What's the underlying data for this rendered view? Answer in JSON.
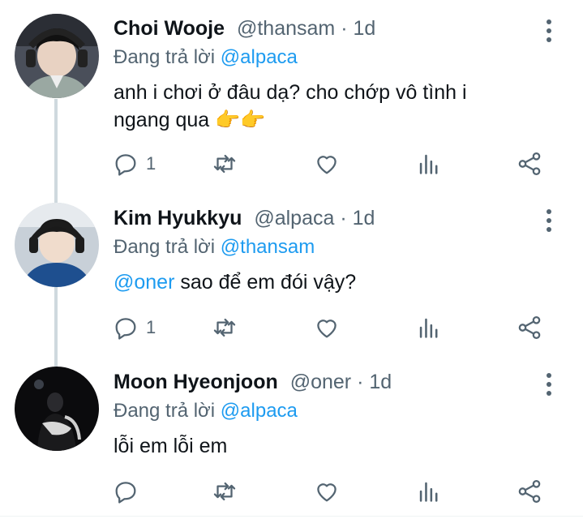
{
  "tweets": [
    {
      "name": "Choi Wooje",
      "handle": "@thansam",
      "dot": "·",
      "time": "1d",
      "replying_prefix": "Đang trả lời",
      "replying_to": "@alpaca",
      "text_lines": [
        "anh i chơi ở đâu dạ? cho chớp vô tình i",
        "ngang qua 👉👉"
      ],
      "reply_count": "1",
      "colors": {
        "avatar_bg": "#3c4250"
      }
    },
    {
      "name": "Kim Hyukkyu",
      "handle": "@alpaca",
      "dot": "·",
      "time": "1d",
      "replying_prefix": "Đang trả lời",
      "replying_to": "@thansam",
      "mention": "@oner",
      "text": "sao để em đói vậy?",
      "reply_count": "1",
      "colors": {
        "avatar_bg": "#b9c3cf"
      }
    },
    {
      "name": "Moon Hyeonjoon",
      "handle": "@oner",
      "dot": "·",
      "time": "1d",
      "replying_prefix": "Đang trả lời",
      "replying_to": "@alpaca",
      "text": "lỗi em lỗi em",
      "reply_count": "",
      "colors": {
        "avatar_bg": "#0b0b0d"
      }
    }
  ],
  "icons": [
    "reply-icon",
    "retweet-icon",
    "like-icon",
    "stats-icon",
    "share-icon",
    "more-icon"
  ],
  "colors": {
    "link": "#1d9bf0",
    "secondary_text": "#536471",
    "thread_line": "#cfd9de"
  }
}
